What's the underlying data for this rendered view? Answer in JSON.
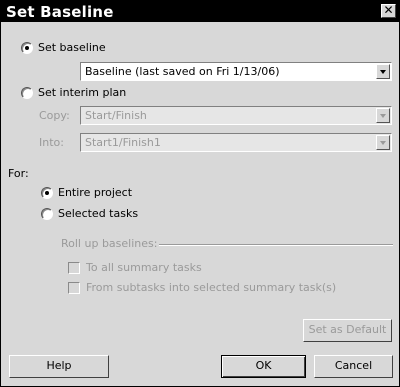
{
  "dialog": {
    "title": "Set Baseline",
    "close_glyph": "✕"
  },
  "set_baseline": {
    "label": "Set baseline",
    "selected": true,
    "value": "Baseline (last saved on Fri 1/13/06)"
  },
  "set_interim": {
    "label": "Set interim plan",
    "selected": false,
    "copy_label": "Copy:",
    "copy_value": "Start/Finish",
    "into_label": "Into:",
    "into_value": "Start1/Finish1"
  },
  "for": {
    "label": "For:",
    "entire_project": "Entire project",
    "selected_tasks": "Selected tasks",
    "selection": "entire_project"
  },
  "rollup": {
    "label": "Roll up baselines:",
    "to_all_summary": "To all summary tasks",
    "from_subtasks": "From subtasks into selected summary task(s)"
  },
  "buttons": {
    "set_as_default": "Set as Default",
    "help": "Help",
    "ok": "OK",
    "cancel": "Cancel"
  }
}
